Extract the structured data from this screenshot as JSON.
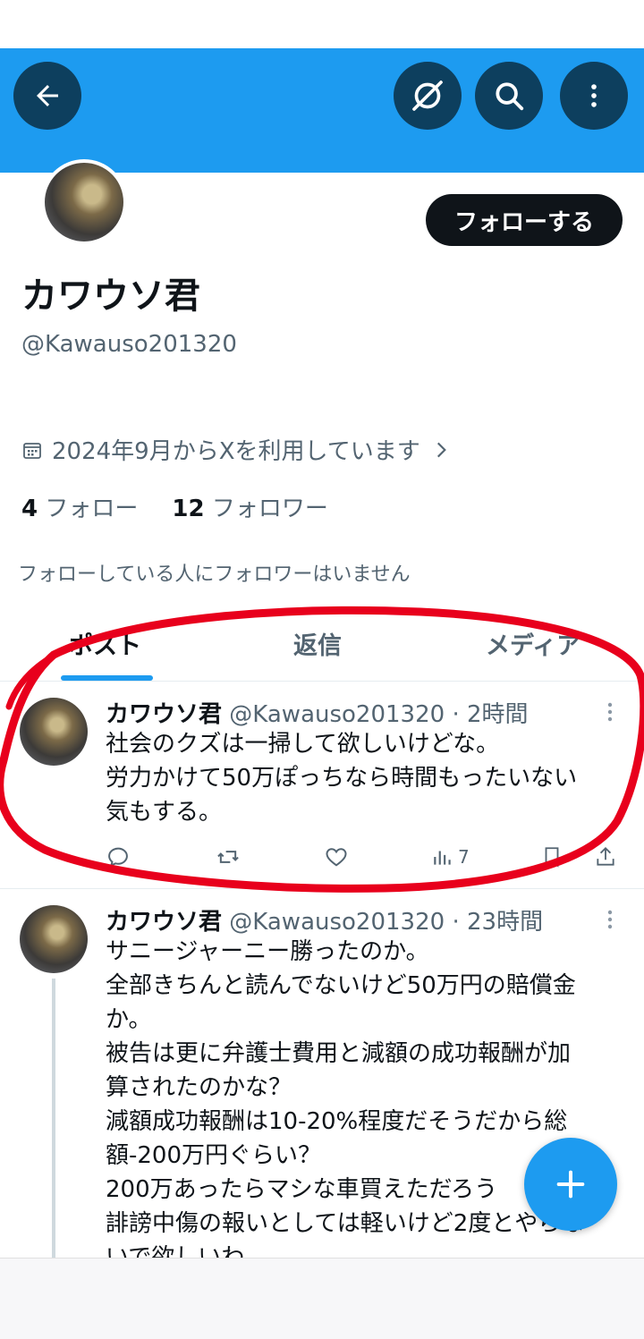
{
  "profile": {
    "display_name": "カワウソ君",
    "handle": "@Kawauso201320",
    "follow_button": "フォローする",
    "joined": "2024年9月からXを利用しています",
    "following_count": "4",
    "following_label": "フォロー",
    "followers_count": "12",
    "followers_label": "フォロワー",
    "no_mutuals": "フォローしている人にフォロワーはいません"
  },
  "tabs": [
    {
      "label": "ポスト"
    },
    {
      "label": "返信"
    },
    {
      "label": "メディア"
    }
  ],
  "posts": [
    {
      "name": "カワウソ君",
      "handle": "@Kawauso201320",
      "time": "· 2時間",
      "lines": [
        "社会のクズは一掃して欲しいけどな。",
        "労力かけて50万ぽっちなら時間もったいない",
        "気もする。"
      ],
      "views": "7"
    },
    {
      "name": "カワウソ君",
      "handle": "@Kawauso201320",
      "time": "· 23時間",
      "lines": [
        "サニージャーニー勝ったのか。",
        "全部きちんと読んでないけど50万円の賠償金",
        "か。",
        "被告は更に弁護士費用と減額の成功報酬が加",
        "算されたのかな？",
        "減額成功報酬は10-20%程度だそうだから総",
        "額-200万円ぐらい？",
        "200万あったらマシな車買えただろう",
        "誹謗中傷の報いとしては軽いけど2度とやらな",
        "いで欲しいわ"
      ]
    }
  ],
  "colors": {
    "header": "#1d9bf0",
    "annotation": "#e8001c",
    "fab": "#1d9bf0"
  }
}
